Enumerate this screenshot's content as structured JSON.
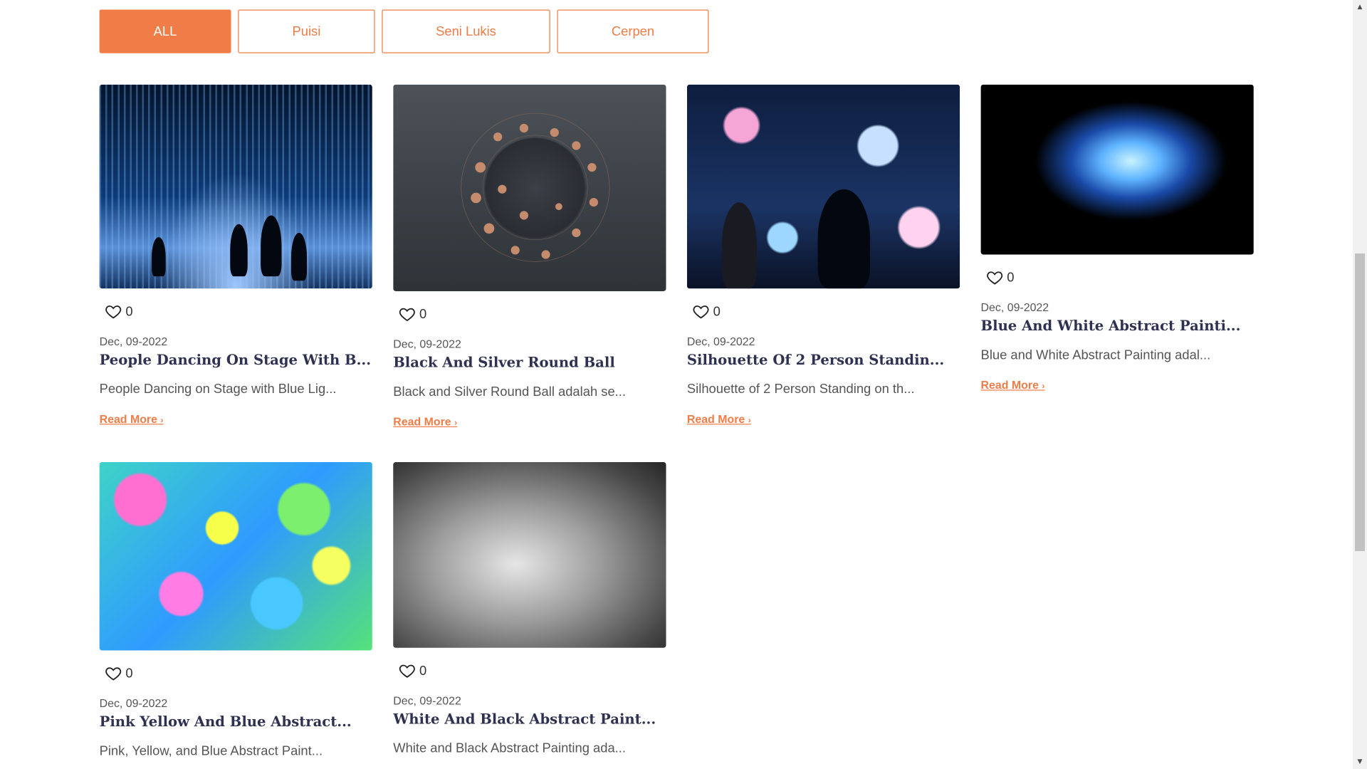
{
  "filters": [
    {
      "label": "ALL",
      "active": true
    },
    {
      "label": "Puisi",
      "active": false
    },
    {
      "label": "Seni Lukis",
      "active": false
    },
    {
      "label": "Cerpen",
      "active": false
    }
  ],
  "cards": [
    {
      "likes": "0",
      "date": "Dec, 09-2022",
      "title": "People Dancing On Stage With B...",
      "description": "People Dancing on Stage with Blue Lig...",
      "read_more": "Read More"
    },
    {
      "likes": "0",
      "date": "Dec, 09-2022",
      "title": "Black And Silver Round Ball",
      "description": "Black and Silver Round Ball adalah se...",
      "read_more": "Read More"
    },
    {
      "likes": "0",
      "date": "Dec, 09-2022",
      "title": "Silhouette Of 2 Person Standin...",
      "description": "Silhouette of 2 Person Standing on th...",
      "read_more": "Read More"
    },
    {
      "likes": "0",
      "date": "Dec, 09-2022",
      "title": "Blue And White Abstract Painti...",
      "description": "Blue and White Abstract Painting adal...",
      "read_more": "Read More"
    },
    {
      "likes": "0",
      "date": "Dec, 09-2022",
      "title": "Pink Yellow And Blue Abstract...",
      "description": "Pink, Yellow, and Blue Abstract Paint..."
    },
    {
      "likes": "0",
      "date": "Dec, 09-2022",
      "title": "White And Black Abstract Paint...",
      "description": "White and Black Abstract Painting ada..."
    }
  ],
  "icons": {
    "like": "heart-icon",
    "read_more_arrow": "chevron-right-icon"
  },
  "colors": {
    "accent": "#f07c48",
    "title": "#2f3151"
  }
}
